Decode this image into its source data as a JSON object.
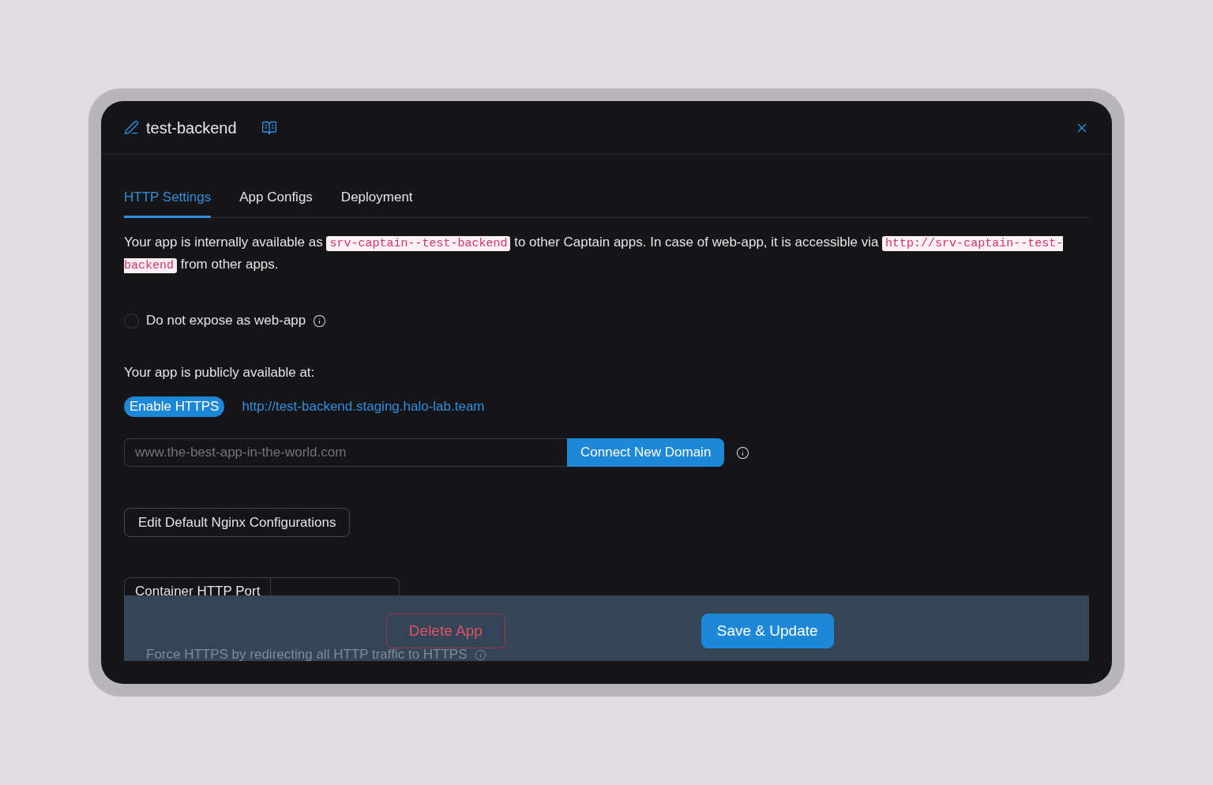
{
  "dialog": {
    "title": "test-backend"
  },
  "tabs": [
    {
      "label": "HTTP Settings",
      "selected": true
    },
    {
      "label": "App Configs",
      "selected": false
    },
    {
      "label": "Deployment",
      "selected": false
    }
  ],
  "internal_address": [
    {
      "kind": "text",
      "text": "Your app is internally available as"
    },
    {
      "kind": "code",
      "text": "srv-captain--test-backend"
    },
    {
      "kind": "text",
      "text": "to other Captain apps. In case of web-app, it is accessible via"
    },
    {
      "kind": "code",
      "text": "http://srv-captain--test-backend"
    },
    {
      "kind": "text",
      "text": "from other apps."
    }
  ],
  "expose_option": {
    "label": "Do not expose as web-app",
    "checked": false
  },
  "public_heading": "Your app is publicly available at:",
  "enable_https_button": "Enable HTTPS",
  "public_url": "http://test-backend.staging.halo-lab.team",
  "domain_field": {
    "placeholder": "www.the-best-app-in-the-world.com"
  },
  "connect_domain_button": "Connect New Domain",
  "nginx_button": "Edit Default Nginx Configurations",
  "container_port": {
    "label": "Container HTTP Port"
  },
  "force_https": {
    "label": "Force HTTPS by redirecting all HTTP traffic to HTTPS"
  },
  "footer": {
    "buttons": [
      {
        "kind": "danger",
        "label": "Delete App"
      },
      {
        "kind": "primary",
        "label": "Save & Update"
      }
    ]
  }
}
